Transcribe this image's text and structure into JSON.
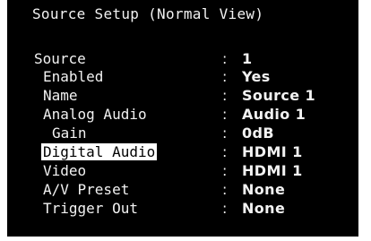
{
  "screen": {
    "title": "Source Setup (Normal View)",
    "rows": [
      {
        "label": "Source",
        "value": "1"
      },
      {
        "label": "Enabled",
        "value": "Yes"
      },
      {
        "label": "Name",
        "value": "Source 1"
      },
      {
        "label": "Analog Audio",
        "value": "Audio 1"
      },
      {
        "label": "Gain",
        "value": "0dB"
      },
      {
        "label": "Digital Audio",
        "value": "HDMI 1",
        "selected": true
      },
      {
        "label": "Video",
        "value": "HDMI 1"
      },
      {
        "label": "A/V Preset",
        "value": "None"
      },
      {
        "label": "Trigger Out",
        "value": "None"
      }
    ],
    "separator": ":",
    "colors": {
      "background": "#000000",
      "text": "#f2f2f2",
      "highlight_bg": "#ffffff",
      "highlight_text": "#000000"
    }
  }
}
